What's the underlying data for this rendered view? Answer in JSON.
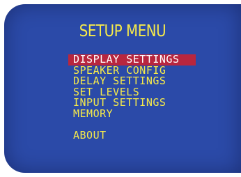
{
  "colors": {
    "background": "#2b4aa8",
    "text": "#f6ea4a",
    "selection": "#b8263e",
    "selected_text": "#ffffff"
  },
  "title": "SETUP MENU",
  "menu": {
    "selected_index": 0,
    "items": [
      {
        "label": "DISPLAY SETTINGS"
      },
      {
        "label": "SPEAKER CONFIG"
      },
      {
        "label": "DELAY SETTINGS"
      },
      {
        "label": "SET LEVELS"
      },
      {
        "label": "INPUT SETTINGS"
      },
      {
        "label": "MEMORY"
      },
      {
        "label": "ABOUT"
      }
    ]
  }
}
